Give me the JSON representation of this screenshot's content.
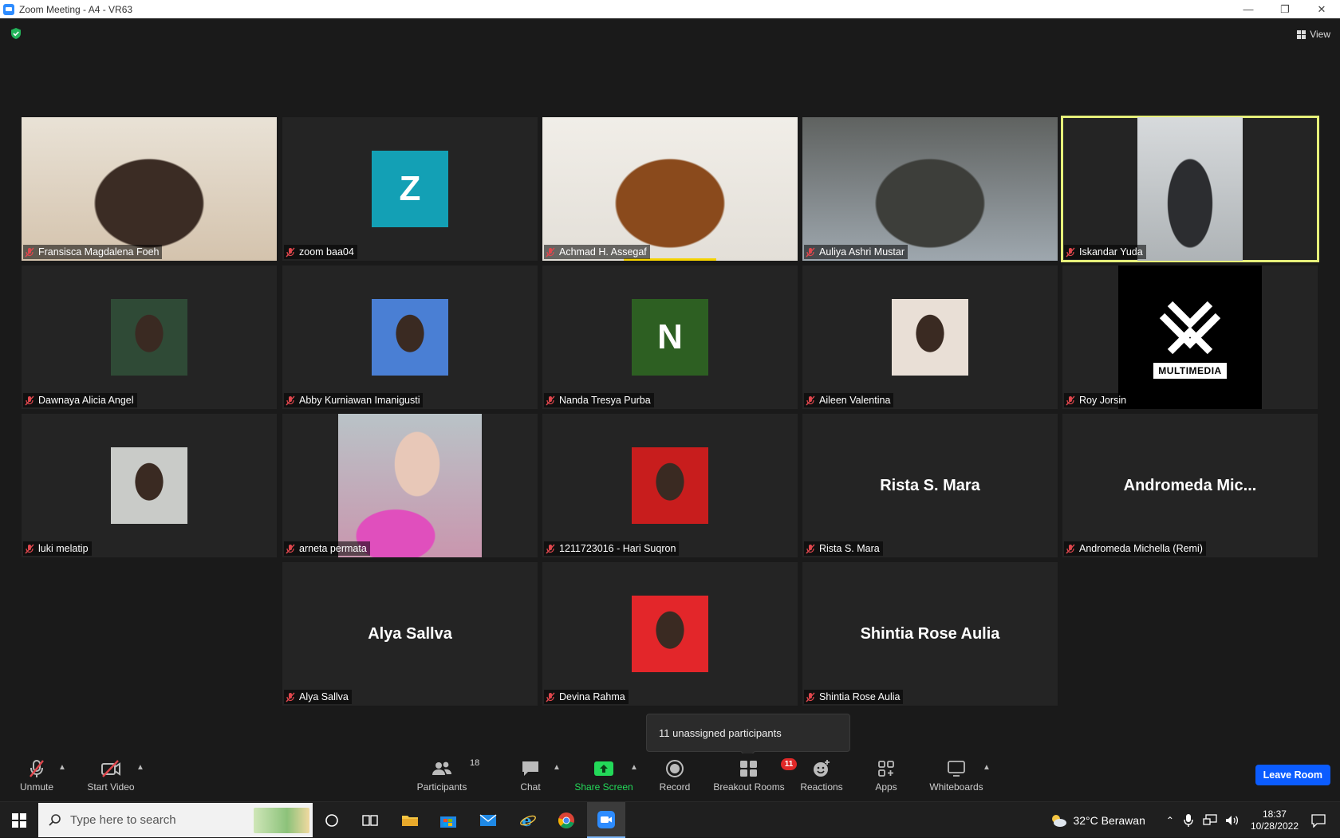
{
  "window": {
    "title": "Zoom Meeting - A4 - VR63"
  },
  "header": {
    "view_label": "View"
  },
  "participants_grid": [
    {
      "name": "Fransisca Magdalena Foeh",
      "kind": "video",
      "colors": [
        "#e9e2d6",
        "#d4c3ad",
        "#3b2c24"
      ]
    },
    {
      "name": "zoom baa04",
      "kind": "avatar",
      "initial": "Z",
      "color": "#13a0b5"
    },
    {
      "name": "Achmad H. Assegaf",
      "kind": "video",
      "colors": [
        "#f1eee8",
        "#e3dfd8",
        "#8a4a1c"
      ],
      "talking": true
    },
    {
      "name": "Auliya Ashri Mustar",
      "kind": "video",
      "colors": [
        "#5f6260",
        "#9ea7ae",
        "#3d3e3a"
      ]
    },
    {
      "name": "Iskandar Yuda",
      "kind": "video",
      "colors": [
        "#d7dadc",
        "#aeb3b6",
        "#2c2d30"
      ],
      "active_speaker": true
    },
    {
      "name": "Dawnaya Alicia Angel",
      "kind": "photo",
      "color": "#2f4a36"
    },
    {
      "name": "Abby Kurniawan Imanigusti",
      "kind": "photo",
      "color": "#4a7fd4"
    },
    {
      "name": "Nanda Tresya Purba",
      "kind": "avatar",
      "initial": "N",
      "color": "#2d5f22"
    },
    {
      "name": "Aileen Valentina",
      "kind": "photo",
      "color": "#e9dfd6"
    },
    {
      "name": "Roy Jorsin",
      "kind": "logo",
      "logo_text": "MULTIMEDIA"
    },
    {
      "name": "luki melatip",
      "kind": "photo",
      "color": "#c9cbc8"
    },
    {
      "name": "arneta permata",
      "kind": "photo-wide",
      "color": "#c996ae"
    },
    {
      "name": "1211723016 - Hari Suqron",
      "kind": "photo",
      "color": "#c81d1d"
    },
    {
      "name": "Rista S. Mara",
      "kind": "name",
      "display": "Rista S. Mara"
    },
    {
      "name": "Andromeda Michella (Remi)",
      "kind": "name",
      "display": "Andromeda  Mic..."
    },
    {
      "name": "Alya Sallva",
      "kind": "name",
      "display": "Alya Sallva"
    },
    {
      "name": "Devina Rahma",
      "kind": "photo",
      "color": "#e3262a"
    },
    {
      "name": "Shintia Rose Aulia",
      "kind": "name",
      "display": "Shintia Rose Aulia"
    }
  ],
  "tooltip": {
    "text": "11 unassigned participants"
  },
  "toolbar": {
    "unmute": "Unmute",
    "start_video": "Start Video",
    "participants": "Participants",
    "participants_count": "18",
    "chat": "Chat",
    "share_screen": "Share Screen",
    "record": "Record",
    "breakout_rooms": "Breakout Rooms",
    "breakout_badge": "11",
    "reactions": "Reactions",
    "apps": "Apps",
    "whiteboards": "Whiteboards",
    "leave_room": "Leave Room"
  },
  "taskbar": {
    "search_placeholder": "Type here to search",
    "weather": "32°C  Berawan",
    "time": "18:37",
    "date": "10/28/2022"
  },
  "colors": {
    "accent": "#0b5cff",
    "speaker_border": "#e6f07a",
    "share_green": "#23d959",
    "mute_red": "#e0474d"
  }
}
